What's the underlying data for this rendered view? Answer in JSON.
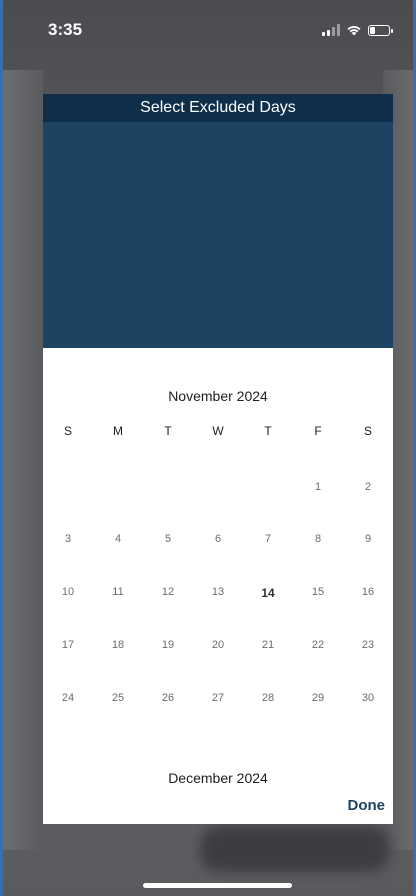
{
  "status_bar": {
    "time": "3:35"
  },
  "modal": {
    "title": "Select Excluded Days",
    "month_current": "November 2024",
    "month_next": "December 2024",
    "weekdays": [
      "S",
      "M",
      "T",
      "W",
      "T",
      "F",
      "S"
    ],
    "weeks": [
      [
        "",
        "",
        "",
        "",
        "",
        "1",
        "2"
      ],
      [
        "3",
        "4",
        "5",
        "6",
        "7",
        "8",
        "9"
      ],
      [
        "10",
        "11",
        "12",
        "13",
        "14",
        "15",
        "16"
      ],
      [
        "17",
        "18",
        "19",
        "20",
        "21",
        "22",
        "23"
      ],
      [
        "24",
        "25",
        "26",
        "27",
        "28",
        "29",
        "30"
      ]
    ],
    "today": "14",
    "done_label": "Done"
  },
  "colors": {
    "header_bg": "#0f2e4a",
    "picker_bg": "#1d4262",
    "accent": "#1d4262"
  }
}
